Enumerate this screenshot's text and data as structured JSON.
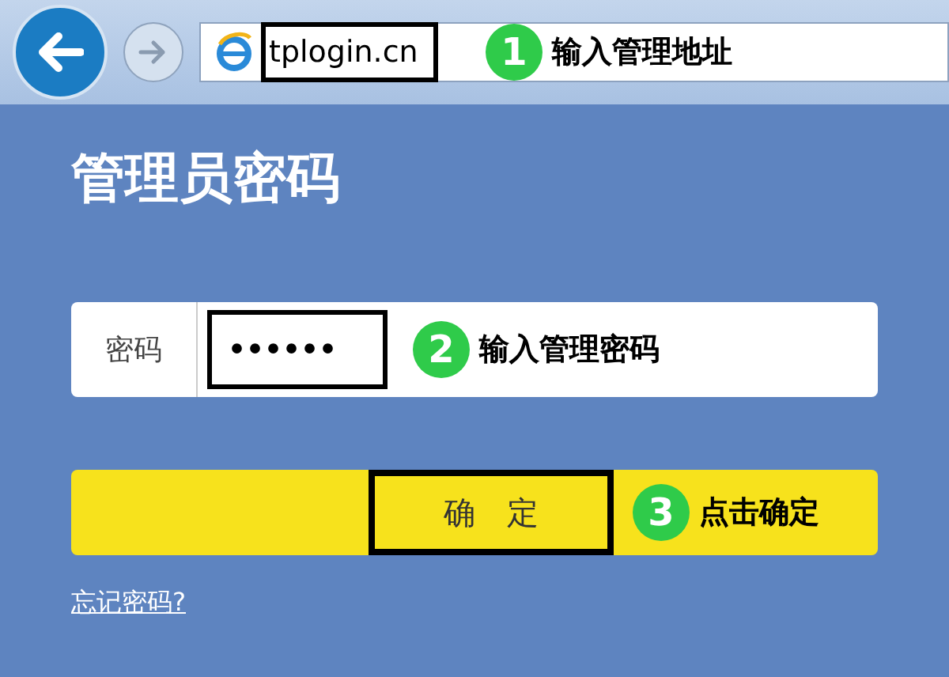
{
  "browser": {
    "url": "tplogin.cn"
  },
  "steps": [
    {
      "number": "1",
      "text": "输入管理地址"
    },
    {
      "number": "2",
      "text": "输入管理密码"
    },
    {
      "number": "3",
      "text": "点击确定"
    }
  ],
  "page": {
    "title": "管理员密码",
    "password_label": "密码",
    "password_value": "••••••",
    "confirm_button": "确　定",
    "forgot_link": "忘记密码?"
  }
}
